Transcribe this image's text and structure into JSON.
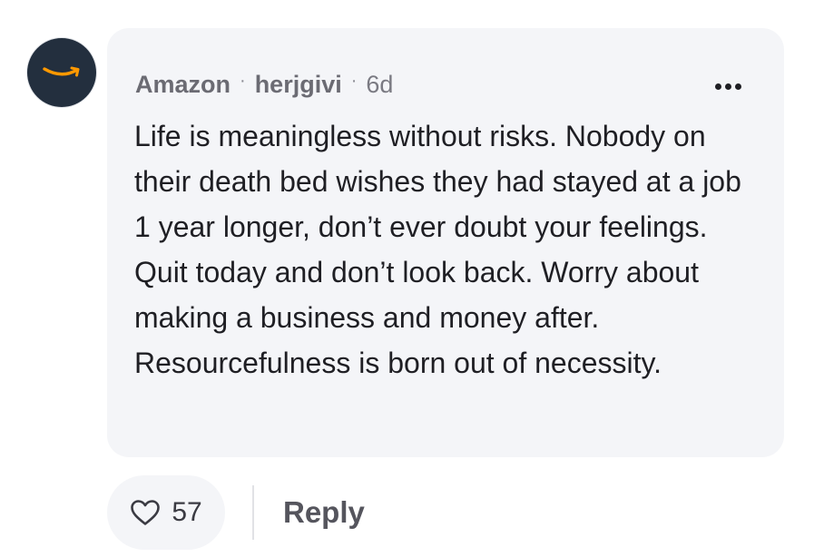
{
  "avatar": {
    "icon": "amazon-smile-logo",
    "bg_color": "#232f3e",
    "accent_color": "#ff9900"
  },
  "comment": {
    "community": "Amazon",
    "author": "herjgivi",
    "age": "6d",
    "separator": "·",
    "text": "Life is meaningless without risks. Nobody on their death bed wishes they had stayed at a job 1 year longer, don’t ever doubt your feelings. Quit today and don’t look back. Worry about making a business and money after. Resourcefulness is born out of necessity."
  },
  "actions": {
    "like_icon": "heart-outline-icon",
    "like_count": "57",
    "reply_label": "Reply",
    "more_icon": "more-horizontal-icon"
  }
}
